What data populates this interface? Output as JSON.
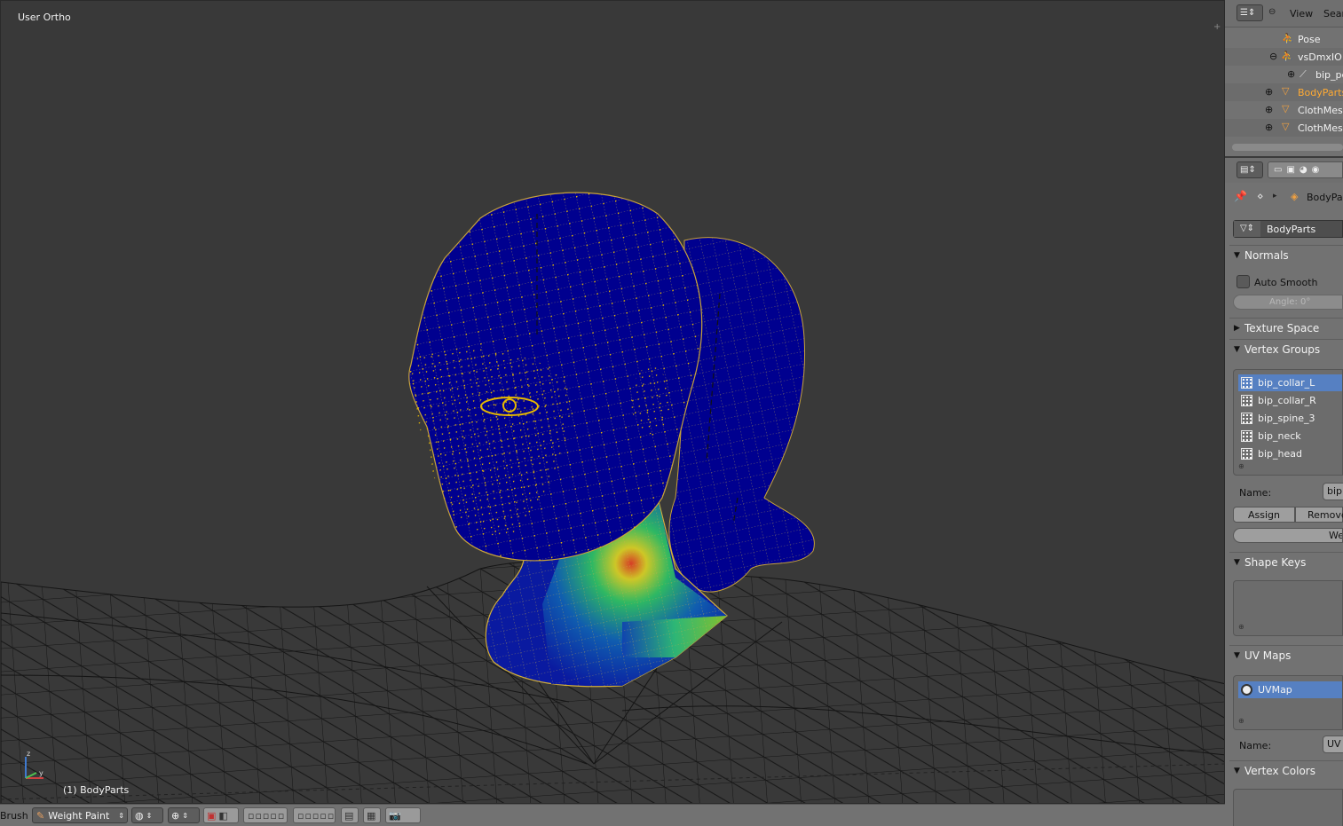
{
  "viewport": {
    "view_label": "User Ortho",
    "object_label": "(1) BodyParts"
  },
  "header3d": {
    "brush_label": "Brush",
    "mode": "Weight Paint"
  },
  "outliner": {
    "menu_view": "View",
    "menu_search": "Sear",
    "rows": [
      {
        "label": "Pose"
      },
      {
        "label": "vsDmxIO S"
      },
      {
        "label": "bip_pe"
      },
      {
        "label": "BodyParts"
      },
      {
        "label": "ClothMesh"
      },
      {
        "label": "ClothMesh"
      }
    ]
  },
  "properties": {
    "breadcrumb": "BodyParts",
    "mesh_name": "BodyParts",
    "normals": {
      "title": "Normals",
      "auto_smooth": "Auto Smooth",
      "angle": "Angle: 0°"
    },
    "texture_space": {
      "title": "Texture Space"
    },
    "vertex_groups": {
      "title": "Vertex Groups",
      "items": [
        "bip_collar_L",
        "bip_collar_R",
        "bip_spine_3",
        "bip_neck",
        "bip_head"
      ],
      "name_label": "Name:",
      "name_value": "bip",
      "assign": "Assign",
      "remove": "Remove",
      "weight": "We"
    },
    "shape_keys": {
      "title": "Shape Keys"
    },
    "uv_maps": {
      "title": "UV Maps",
      "items": [
        "UVMap"
      ],
      "name_label": "Name:",
      "name_value": "UV"
    },
    "vertex_colors": {
      "title": "Vertex Colors"
    }
  },
  "colors": {
    "viewport_bg": "#393939",
    "mesh_blue": "#00008f",
    "vertex_yellow": "#e6b800",
    "selection_blue": "#5680c2",
    "outliner_highlight": "#ffaa33"
  }
}
